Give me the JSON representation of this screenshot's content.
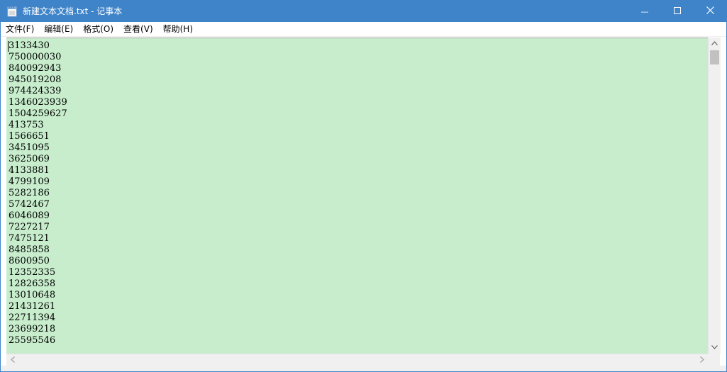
{
  "window": {
    "title": "新建文本文档.txt - 记事本",
    "minimize_glyph": "—",
    "maximize_glyph": "☐",
    "close_glyph": "✕"
  },
  "menu": [
    {
      "label": "文件(F)"
    },
    {
      "label": "编辑(E)"
    },
    {
      "label": "格式(O)"
    },
    {
      "label": "查看(V)"
    },
    {
      "label": "帮助(H)"
    }
  ],
  "editor": {
    "lines": [
      "3133430",
      "750000030",
      "840092943",
      "945019208",
      "974424339",
      "1346023939",
      "1504259627",
      "413753",
      "1566651",
      "3451095",
      "3625069",
      "4133881",
      "4799109",
      "5282186",
      "5742467",
      "6046089",
      "7227217",
      "7475121",
      "8485858",
      "8600950",
      "12352335",
      "12826358",
      "13010648",
      "21431261",
      "22711394",
      "23699218",
      "25595546"
    ],
    "background": "#c7edcc"
  },
  "scrollbar": {
    "up_glyph": "▲",
    "down_glyph": "▼",
    "left_glyph": "◀",
    "right_glyph": "▶"
  },
  "colors": {
    "titlebar": "#3f84c9",
    "editor_bg": "#c7edcc"
  }
}
